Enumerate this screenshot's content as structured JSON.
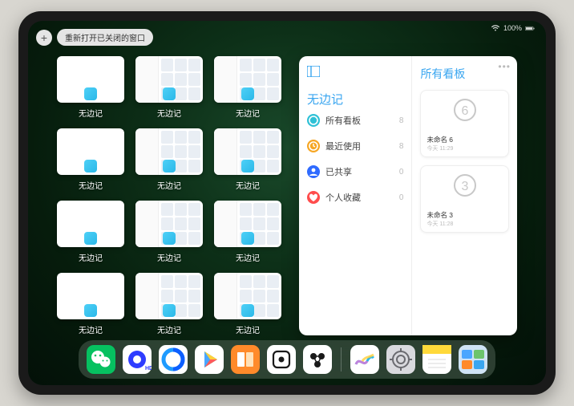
{
  "status": {
    "battery": "100%"
  },
  "topbar": {
    "reopen_label": "重新打开已关闭的窗口",
    "plus": "+"
  },
  "thumbs": {
    "label": "无边记",
    "items": [
      {
        "kind": "blank"
      },
      {
        "kind": "content"
      },
      {
        "kind": "content"
      },
      {
        "kind": "blank"
      },
      {
        "kind": "content"
      },
      {
        "kind": "content"
      },
      {
        "kind": "blank"
      },
      {
        "kind": "content"
      },
      {
        "kind": "content"
      },
      {
        "kind": "blank"
      },
      {
        "kind": "content"
      },
      {
        "kind": "content"
      }
    ]
  },
  "panel": {
    "title": "无边记",
    "right_title": "所有看板",
    "list": [
      {
        "icon": "circle",
        "color": "#2fc1d6",
        "label": "所有看板",
        "count": "8"
      },
      {
        "icon": "clock",
        "color": "#f6a623",
        "label": "最近使用",
        "count": "8"
      },
      {
        "icon": "person",
        "color": "#2f6bff",
        "label": "已共享",
        "count": "0"
      },
      {
        "icon": "heart",
        "color": "#ff4d4d",
        "label": "个人收藏",
        "count": "0"
      }
    ],
    "boards": [
      {
        "digit": "6",
        "name": "未命名 6",
        "date": "今天 11:29"
      },
      {
        "digit": "3",
        "name": "未命名 3",
        "date": "今天 11:28"
      }
    ]
  },
  "dock": {
    "apps": [
      {
        "name": "wechat-icon",
        "bg": "#06c160"
      },
      {
        "name": "quark-icon",
        "bg": "#ffffff"
      },
      {
        "name": "qqbrowser-icon",
        "bg": "#ffffff"
      },
      {
        "name": "play-icon",
        "bg": "#ffffff"
      },
      {
        "name": "books-icon",
        "bg": "linear-gradient(135deg,#ff9b3d,#ff7a1a)"
      },
      {
        "name": "dice-icon",
        "bg": "#ffffff"
      },
      {
        "name": "atoms-icon",
        "bg": "#ffffff"
      }
    ],
    "recent": [
      {
        "name": "freeform-icon",
        "bg": "#ffffff"
      },
      {
        "name": "settings-icon",
        "bg": "#d9d9de"
      },
      {
        "name": "notes-icon",
        "bg": "#ffffff"
      },
      {
        "name": "folder-icon",
        "bg": "#c0d8ef"
      }
    ]
  }
}
